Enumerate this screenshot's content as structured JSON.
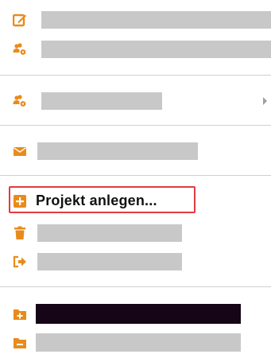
{
  "menu": {
    "accent_color": "#e98b1a",
    "items": [
      {
        "icon": "edit-icon",
        "label": ""
      },
      {
        "icon": "users-cog-icon",
        "label": ""
      },
      {
        "icon": "users-cog-icon",
        "label": "",
        "has_submenu": true
      },
      {
        "icon": "envelope-icon",
        "label": ""
      },
      {
        "icon": "plus-square-icon",
        "label": "Projekt anlegen...",
        "highlighted": true
      },
      {
        "icon": "trash-icon",
        "label": ""
      },
      {
        "icon": "sign-out-icon",
        "label": ""
      },
      {
        "icon": "folder-plus-icon",
        "label": ""
      },
      {
        "icon": "folder-minus-icon",
        "label": ""
      }
    ]
  }
}
